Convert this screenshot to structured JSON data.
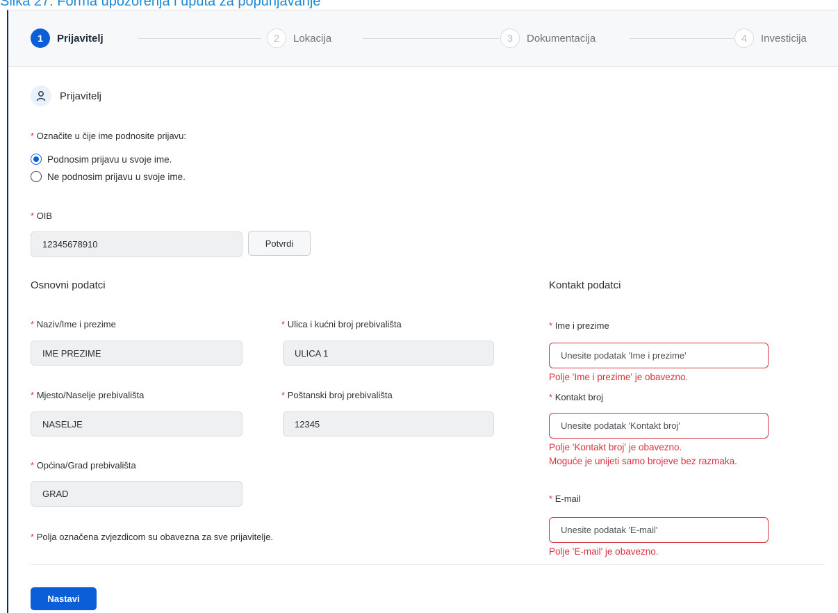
{
  "caption": "Slika 27: Forma upozorenja i uputa za popunjavanje",
  "stepper": {
    "steps": [
      {
        "num": "1",
        "label": "Prijavitelj"
      },
      {
        "num": "2",
        "label": "Lokacija"
      },
      {
        "num": "3",
        "label": "Dokumentacija"
      },
      {
        "num": "4",
        "label": "Investicija"
      }
    ]
  },
  "section": {
    "title": "Prijavitelj",
    "icon": "user-icon"
  },
  "choice": {
    "required_mark": "*",
    "label": "Označite u čije ime podnosite prijavu:",
    "options": [
      "Podnosim prijavu u svoje ime.",
      "Ne podnosim prijavu u svoje ime."
    ],
    "selected": "Podnosim prijavu u svoje ime."
  },
  "oib": {
    "label": "OIB",
    "value": "12345678910",
    "button": "Potvrdi"
  },
  "basic": {
    "title": "Osnovni podatci",
    "name_label": "Naziv/Ime i prezime",
    "name_value": "IME PREZIME",
    "street_label": "Ulica i kućni broj prebivališta",
    "street_value": "ULICA 1",
    "place_label": "Mjesto/Naselje prebivališta",
    "place_value": "NASELJE",
    "postal_label": "Poštanski broj prebivališta",
    "postal_value": "12345",
    "city_label": "Općina/Grad prebivališta",
    "city_value": "GRAD"
  },
  "contact": {
    "title": "Kontakt podatci",
    "name_label": "Ime i prezime",
    "name_placeholder": "Unesite podatak 'Ime i prezime'",
    "name_error": "Polje 'Ime i prezime' je obavezno.",
    "phone_label": "Kontakt broj",
    "phone_placeholder": "Unesite podatak 'Kontakt broj'",
    "phone_error1": "Polje 'Kontakt broj' je obavezno.",
    "phone_error2": "Moguće je unijeti samo brojeve bez razmaka.",
    "email_label": "E-mail",
    "email_placeholder": "Unesite podatak 'E-mail'",
    "email_error": "Polje 'E-mail' je obavezno."
  },
  "note": "Polja označena zvjezdicom su obavezna za sve prijavitelje.",
  "continue_button": "Nastavi",
  "colors": {
    "primary": "#0b5ed7",
    "error": "#d9303f",
    "required": "#dc3545"
  }
}
